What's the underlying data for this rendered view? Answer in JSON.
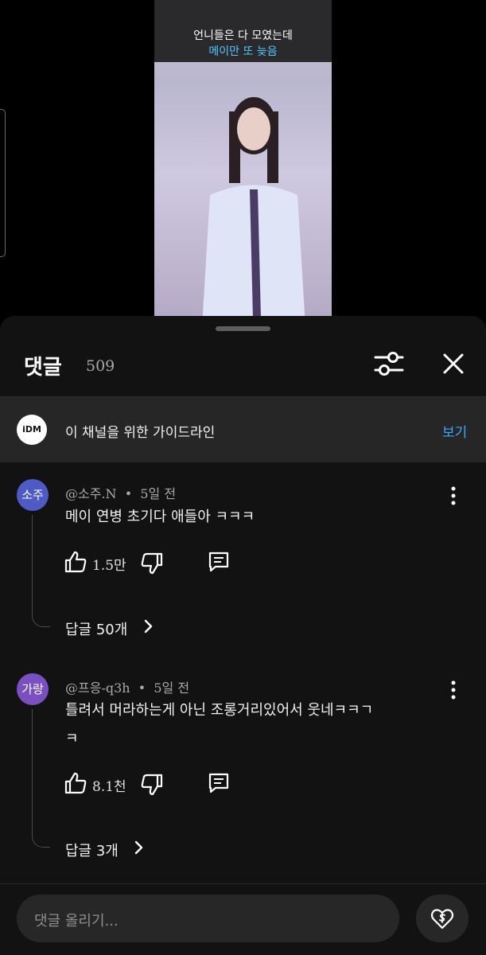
{
  "video": {
    "caption_line1": "언니들은 다 모였는데",
    "caption_line2": "메이만 또 늦음",
    "caption_accent_color": "#55c7ff"
  },
  "comments_panel": {
    "title": "댓글",
    "count": "509",
    "filter_icon": "sliders-icon",
    "close_icon": "close-icon"
  },
  "guideline": {
    "logo_text": "iDM",
    "text": "이 채널을 위한 가이드라인",
    "link": "보기",
    "link_color": "#3ea6ff"
  },
  "comments": [
    {
      "avatar_text": "소주",
      "avatar_color": "#4f5bc4",
      "author": "@소주.N",
      "time": "5일 전",
      "text_lines": [
        "메이 연병 초기다 애들아 ㅋㅋㅋ"
      ],
      "likes": "1.5만",
      "replies": "답글 50개"
    },
    {
      "avatar_text": "가랑",
      "avatar_color": "#7a4fc2",
      "author": "@프응-q3h",
      "time": "5일 전",
      "text_lines": [
        "틀려서 머라하는게 아닌 조롱거리있어서 웃네ㅋㅋㄱ",
        "ㅋ"
      ],
      "likes": "8.1천",
      "replies": "답글 3개"
    }
  ],
  "composer": {
    "placeholder": "댓글 올리기...",
    "thanks_icon": "heart-dollar-icon"
  }
}
